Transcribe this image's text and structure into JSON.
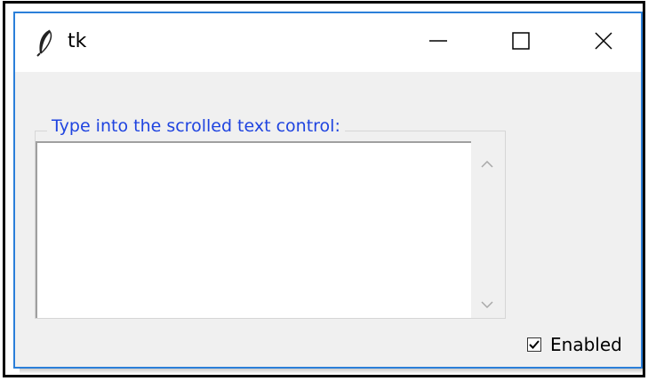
{
  "window": {
    "title": "tk",
    "controls": {
      "minimize_icon": "minimize-icon",
      "maximize_icon": "maximize-icon",
      "close_icon": "close-icon"
    }
  },
  "group": {
    "label": "Type into the scrolled text control:"
  },
  "text_area": {
    "value": ""
  },
  "checkbox": {
    "label": "Enabled",
    "checked": true
  },
  "colors": {
    "window_border": "#2b7fd9",
    "group_label": "#1f44e0",
    "background": "#f0f0f0"
  }
}
